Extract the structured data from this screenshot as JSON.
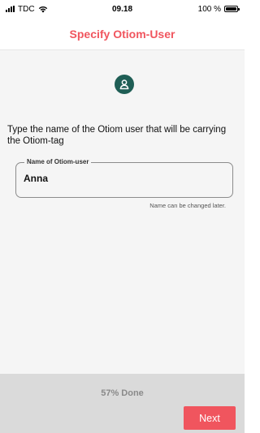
{
  "status_bar": {
    "carrier": "TDC",
    "time": "09.18",
    "battery_text": "100 %",
    "icons": [
      "signal-icon",
      "wifi-icon",
      "battery-icon"
    ]
  },
  "header": {
    "title": "Specify Otiom-User",
    "title_color": "#f0555e"
  },
  "main": {
    "avatar_icon": "user-icon",
    "avatar_color": "#1f5e55",
    "prompt": "Type the name of the Otiom user that will be carrying the Otiom-tag",
    "name_field": {
      "label": "Name of Otiom-user",
      "value": "Anna"
    },
    "hint": "Name can be changed later."
  },
  "footer": {
    "progress_label": "57% Done",
    "next_label": "Next",
    "next_color": "#f0555e"
  }
}
